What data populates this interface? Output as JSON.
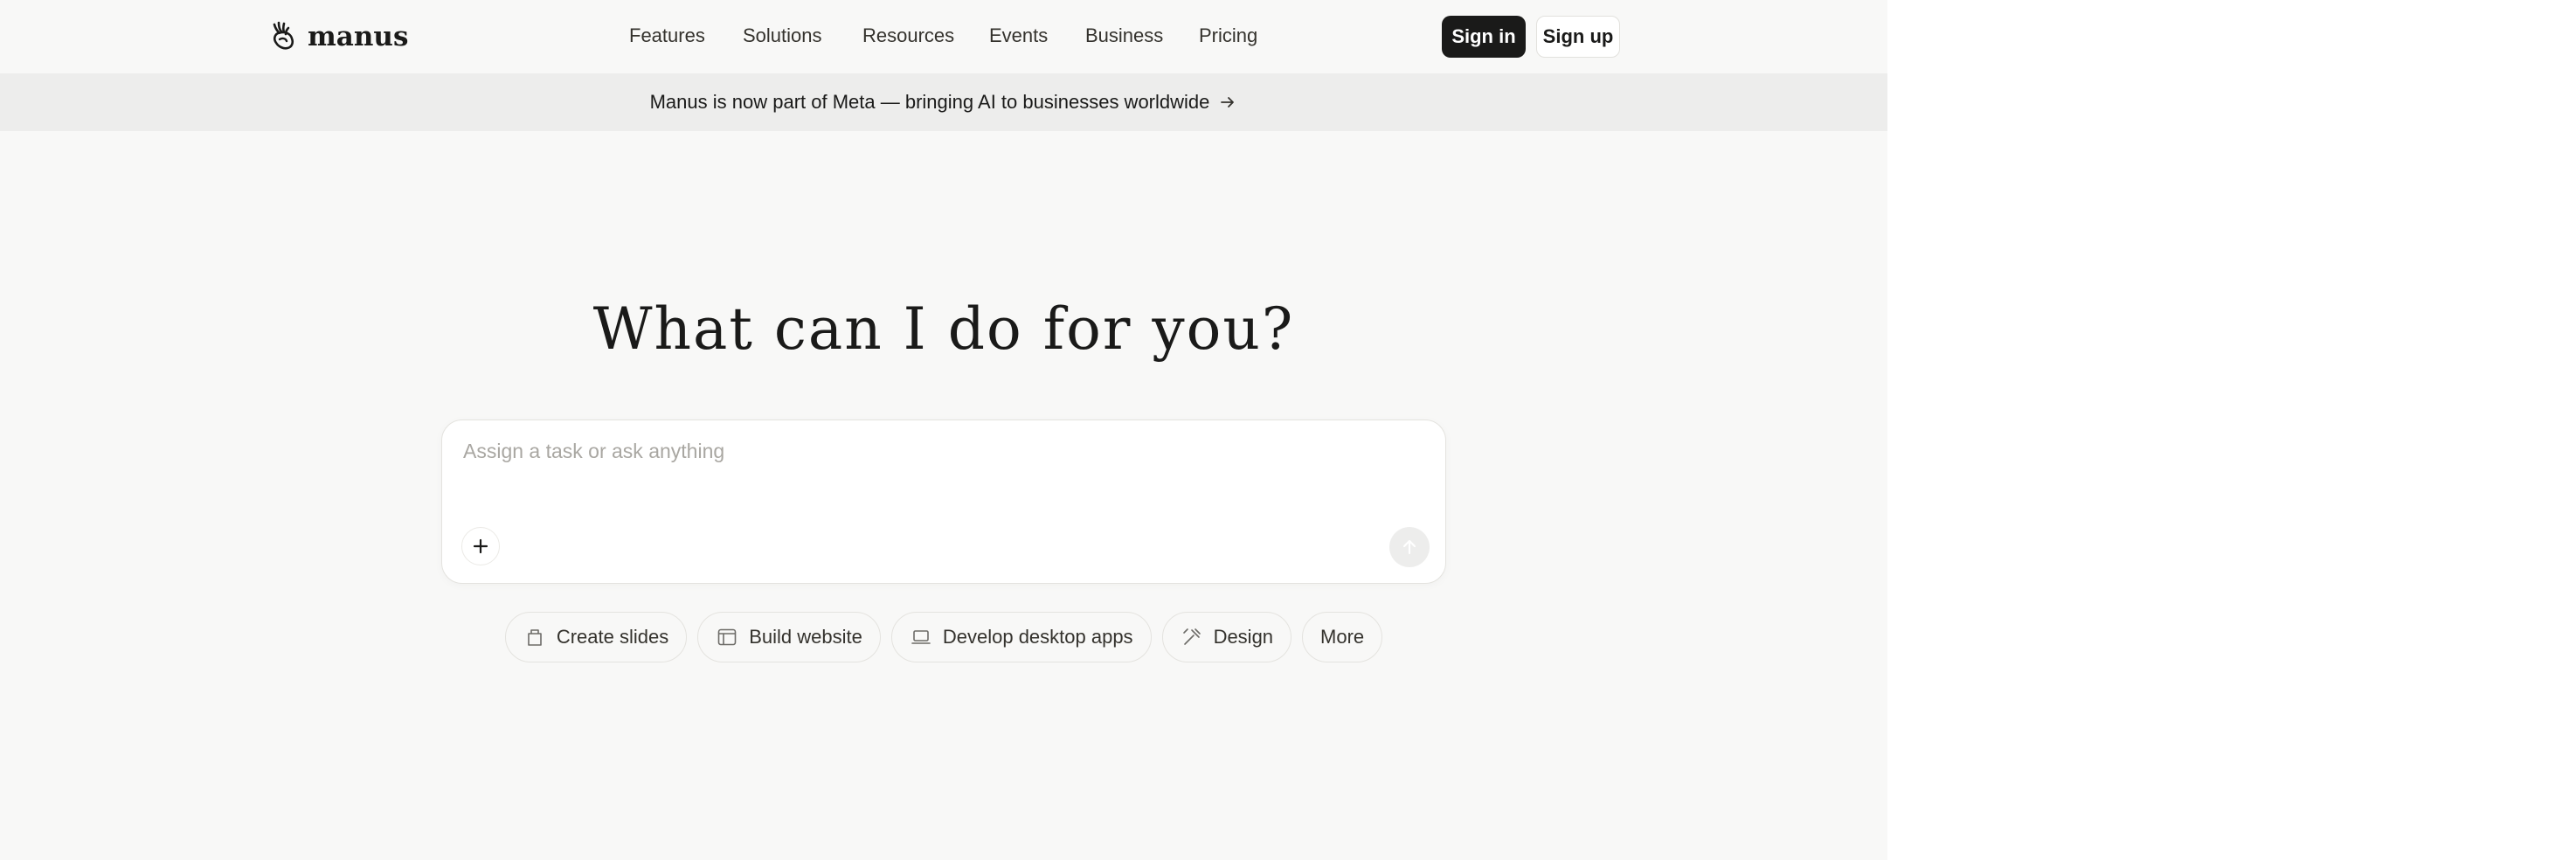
{
  "brand": {
    "name": "manus",
    "logo_icon": "manus-hand-logo-icon"
  },
  "nav": {
    "items": [
      {
        "label": "Features"
      },
      {
        "label": "Solutions"
      },
      {
        "label": "Resources"
      },
      {
        "label": "Events"
      },
      {
        "label": "Business"
      },
      {
        "label": "Pricing"
      }
    ],
    "sign_in": "Sign in",
    "sign_up": "Sign up"
  },
  "banner": {
    "text": "Manus is now part of Meta — bringing AI to businesses worldwide",
    "icon": "arrow-right-icon"
  },
  "hero": {
    "title": "What can I do for you?"
  },
  "composer": {
    "placeholder": "Assign a task or ask anything",
    "value": "",
    "add_icon": "plus-icon",
    "send_icon": "arrow-up-icon"
  },
  "quick_actions": [
    {
      "label": "Create slides",
      "icon": "slides-icon"
    },
    {
      "label": "Build website",
      "icon": "website-icon"
    },
    {
      "label": "Develop desktop apps",
      "icon": "laptop-icon"
    },
    {
      "label": "Design",
      "icon": "design-pen-icon"
    },
    {
      "label": "More"
    }
  ],
  "colors": {
    "background": "#f8f8f7",
    "banner_bg": "#ededec",
    "primary_button": "#1a1a19",
    "text": "#34322d",
    "placeholder": "#a9a7a2"
  }
}
